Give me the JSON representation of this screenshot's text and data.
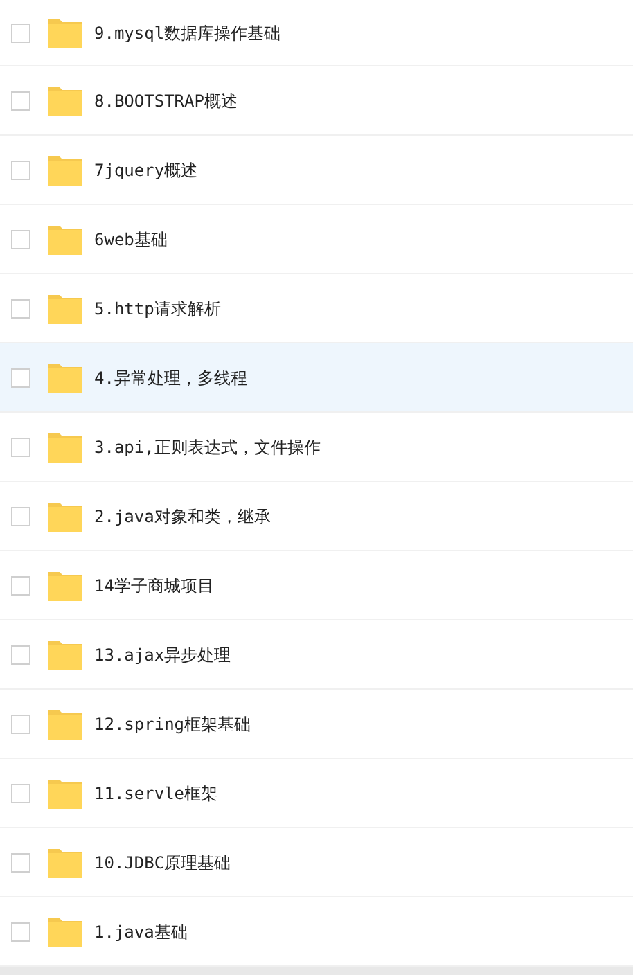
{
  "files": [
    {
      "name": "9.mysql数据库操作基础",
      "checked": false,
      "highlighted": false
    },
    {
      "name": "8.BOOTSTRAP概述",
      "checked": false,
      "highlighted": false
    },
    {
      "name": "7jquery概述",
      "checked": false,
      "highlighted": false
    },
    {
      "name": "6web基础",
      "checked": false,
      "highlighted": false
    },
    {
      "name": "5.http请求解析",
      "checked": false,
      "highlighted": false
    },
    {
      "name": "4.异常处理，多线程",
      "checked": false,
      "highlighted": true
    },
    {
      "name": "3.api,正则表达式，文件操作",
      "checked": false,
      "highlighted": false
    },
    {
      "name": "2.java对象和类，继承",
      "checked": false,
      "highlighted": false
    },
    {
      "name": "14学子商城项目",
      "checked": false,
      "highlighted": false
    },
    {
      "name": "13.ajax异步处理",
      "checked": false,
      "highlighted": false
    },
    {
      "name": "12.spring框架基础",
      "checked": false,
      "highlighted": false
    },
    {
      "name": "11.servle框架",
      "checked": false,
      "highlighted": false
    },
    {
      "name": "10.JDBC原理基础",
      "checked": false,
      "highlighted": false
    },
    {
      "name": "1.java基础",
      "checked": false,
      "highlighted": false
    }
  ]
}
